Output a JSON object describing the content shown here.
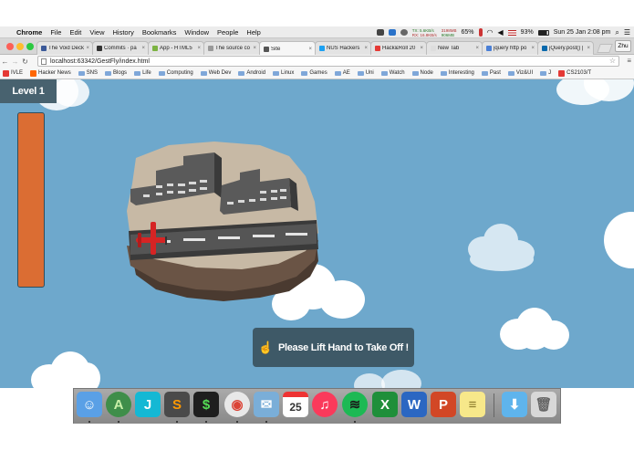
{
  "menubar": {
    "app_name": "Chrome",
    "items": [
      "File",
      "Edit",
      "View",
      "History",
      "Bookmarks",
      "Window",
      "People",
      "Help"
    ],
    "net_tx": "TX: 5.6KB/s",
    "net_rx": "RX: 16.8KB/s",
    "mem_used": "3198MB",
    "mem_free": "906MB",
    "cpu": "65%",
    "battery": "93%",
    "datetime": "Sun 25 Jan  2:08 pm"
  },
  "tabs": [
    {
      "title": "The Void Deck",
      "color": "#3b5998"
    },
    {
      "title": "Commits · pa",
      "color": "#333333"
    },
    {
      "title": "App - HTML5",
      "color": "#7cb342"
    },
    {
      "title": "The source co",
      "color": "#999999"
    },
    {
      "title": "Site",
      "color": "#555555",
      "active": true
    },
    {
      "title": "NUS Hackers",
      "color": "#1da1f2"
    },
    {
      "title": "Hack&Roll 20",
      "color": "#e53935"
    },
    {
      "title": "New Tab",
      "color": "#dddddd"
    },
    {
      "title": "jquery http po",
      "color": "#4a7fd6"
    },
    {
      "title": "jQuery.post() |",
      "color": "#0868ac"
    }
  ],
  "user_button": "Zhu",
  "url": "localhost:63342/GestFly/index.html",
  "bookmarks": [
    {
      "label": "IVLE",
      "kind": "site",
      "color": "#e53935"
    },
    {
      "label": "Hacker News",
      "kind": "site",
      "color": "#ff6600"
    },
    {
      "label": "SNS",
      "kind": "folder"
    },
    {
      "label": "Blogs",
      "kind": "folder"
    },
    {
      "label": "Life",
      "kind": "folder"
    },
    {
      "label": "Computing",
      "kind": "folder"
    },
    {
      "label": "Web Dev",
      "kind": "folder"
    },
    {
      "label": "Android",
      "kind": "folder"
    },
    {
      "label": "Linux",
      "kind": "folder"
    },
    {
      "label": "Games",
      "kind": "folder"
    },
    {
      "label": "AE",
      "kind": "folder"
    },
    {
      "label": "Uni",
      "kind": "folder"
    },
    {
      "label": "Watch",
      "kind": "folder"
    },
    {
      "label": "Node",
      "kind": "folder"
    },
    {
      "label": "Interesting",
      "kind": "folder"
    },
    {
      "label": "Past",
      "kind": "folder"
    },
    {
      "label": "Viz&UI",
      "kind": "folder"
    },
    {
      "label": "J",
      "kind": "folder"
    },
    {
      "label": "CS2103/T",
      "kind": "site",
      "color": "#e53935"
    }
  ],
  "game": {
    "level_label": "Level 1",
    "prompt": "Please Lift Hand to Take Off !",
    "sky_color": "#6ea8cc",
    "fuel_color": "#db6d33",
    "plane_color": "#d62424"
  },
  "dock": {
    "apps": [
      {
        "name": "finder-icon",
        "bg": "#5aa0e6",
        "glyph": "☺",
        "color": "#ffffff",
        "running": true
      },
      {
        "name": "android-studio-icon",
        "bg": "#3f8e4a",
        "glyph": "A",
        "color": "#c9f0a8",
        "running": true
      },
      {
        "name": "webstorm-icon",
        "bg": "#14b8d4",
        "glyph": "J",
        "color": "#ffffff",
        "running": false
      },
      {
        "name": "sublime-text-icon",
        "bg": "#4a4a4a",
        "glyph": "S",
        "color": "#ff9800",
        "running": true
      },
      {
        "name": "terminal-icon",
        "bg": "#1e1e1e",
        "glyph": "$",
        "color": "#55dd55",
        "running": true
      },
      {
        "name": "chrome-icon",
        "bg": "#e8e8e8",
        "glyph": "◉",
        "color": "#db4437",
        "running": true
      },
      {
        "name": "preview-icon",
        "bg": "#7aaed8",
        "glyph": "✉",
        "color": "#ffffff",
        "running": true
      },
      {
        "name": "calendar-icon",
        "bg": "#ffffff",
        "glyph": "25",
        "color": "#333333",
        "running": false
      },
      {
        "name": "itunes-icon",
        "bg": "#fa3a5b",
        "glyph": "♫",
        "color": "#ffffff",
        "running": false
      },
      {
        "name": "spotify-icon",
        "bg": "#1db954",
        "glyph": "≋",
        "color": "#1a1a1a",
        "running": true
      },
      {
        "name": "excel-icon",
        "bg": "#1f8f3a",
        "glyph": "X",
        "color": "#ffffff",
        "running": false
      },
      {
        "name": "word-icon",
        "bg": "#2b67c2",
        "glyph": "W",
        "color": "#ffffff",
        "running": false
      },
      {
        "name": "powerpoint-icon",
        "bg": "#d24726",
        "glyph": "P",
        "color": "#ffffff",
        "running": false
      },
      {
        "name": "notes-icon",
        "bg": "#f7e88a",
        "glyph": "≡",
        "color": "#8a7a2a",
        "running": false
      },
      {
        "name": "downloads-folder-icon",
        "bg": "#5fb4ec",
        "glyph": "⬇",
        "color": "#ffffff",
        "running": false
      },
      {
        "name": "trash-icon",
        "bg": "#d8d8d8",
        "glyph": "🗑",
        "color": "#666666",
        "running": false
      }
    ]
  }
}
